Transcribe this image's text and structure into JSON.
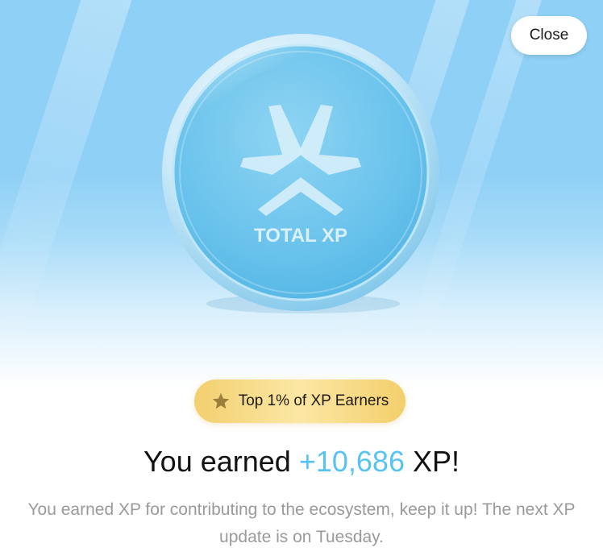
{
  "close_button": {
    "label": "Close"
  },
  "coin": {
    "label": "TOTAL XP",
    "icon": "xp-logo-icon",
    "face_color": "#6ac3ec",
    "rim_color": "#d9f0fb"
  },
  "badge": {
    "icon": "star-icon",
    "label": "Top 1% of XP Earners",
    "color": "#f5d77e"
  },
  "headline": {
    "prefix": "You earned",
    "amount": "+10,686",
    "suffix": "XP!",
    "amount_color": "#57c3f2"
  },
  "message": "You earned XP for contributing to the ecosystem, keep it up! The next XP update is on Tuesday."
}
